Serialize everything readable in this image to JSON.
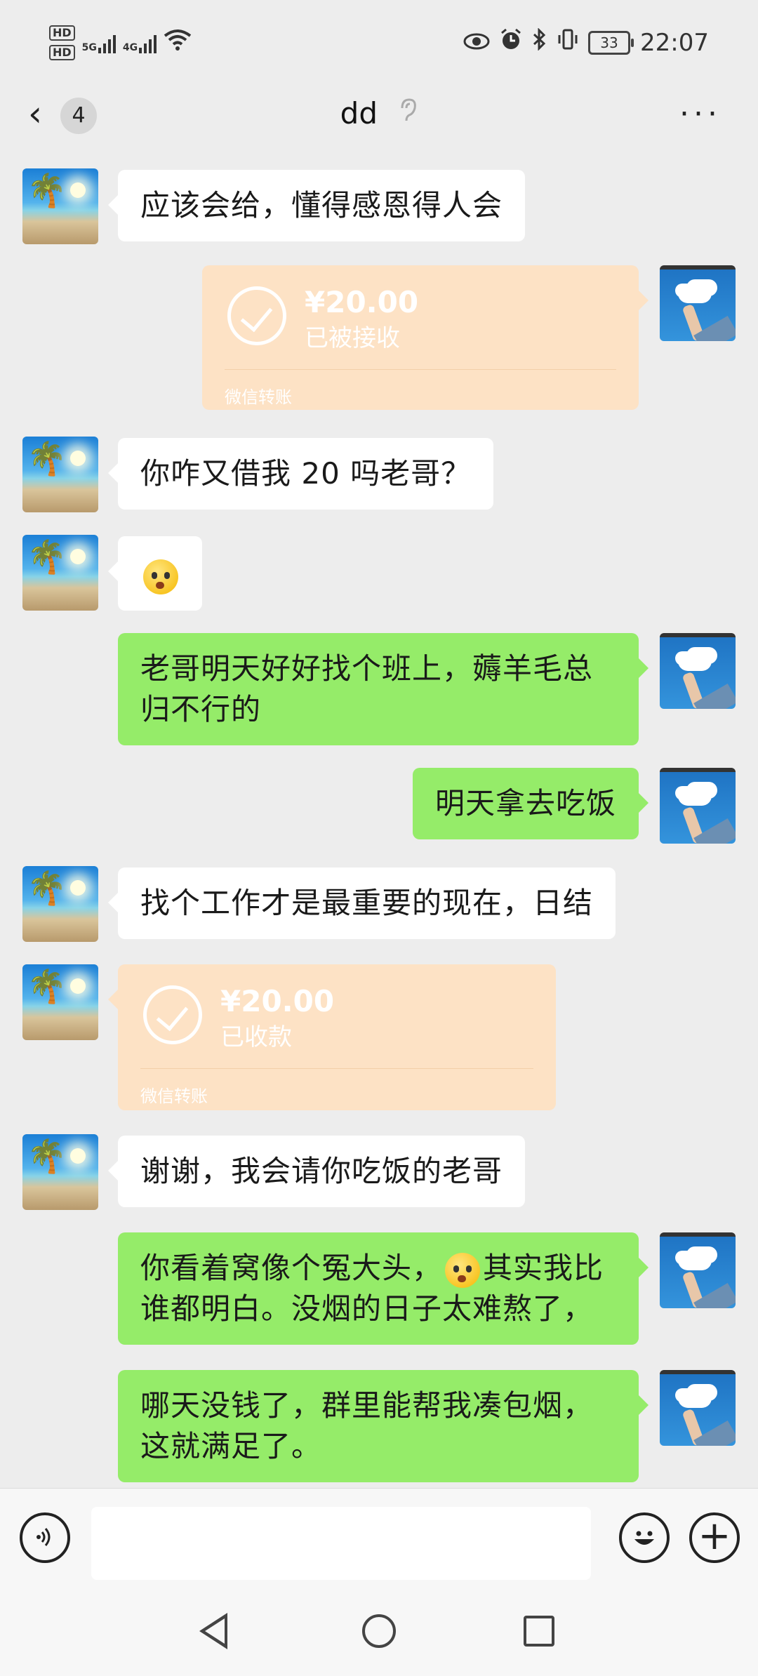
{
  "status_bar": {
    "hd1": "HD",
    "hd2": "HD",
    "net1": "5G",
    "net2": "4G",
    "battery": "33",
    "time": "22:07"
  },
  "header": {
    "back_symbol": "‹",
    "unread_count": "4",
    "title": "dd",
    "ear_icon": "ear-icon",
    "more_icon": "···"
  },
  "messages": [
    {
      "side": "left",
      "type": "text",
      "text": "应该会给，懂得感恩得人会"
    },
    {
      "side": "right",
      "type": "transfer",
      "amount": "¥20.00",
      "status": "已被接收",
      "footer": "微信转账"
    },
    {
      "side": "left",
      "type": "text",
      "text": "你咋又借我 20 吗老哥？"
    },
    {
      "side": "left",
      "type": "emoji",
      "icon": "shocked-face-emoji"
    },
    {
      "side": "right",
      "type": "text",
      "text": "老哥明天好好找个班上，薅羊毛总归不行的"
    },
    {
      "side": "right",
      "type": "text",
      "text": "明天拿去吃饭"
    },
    {
      "side": "left",
      "type": "text",
      "text": "找个工作才是最重要的现在，日结"
    },
    {
      "side": "left",
      "type": "transfer",
      "amount": "¥20.00",
      "status": "已收款",
      "footer": "微信转账"
    },
    {
      "side": "left",
      "type": "text",
      "text": "谢谢，我会请你吃饭的老哥"
    },
    {
      "side": "right",
      "type": "text",
      "text_before": "你看着窝像个冤大头，",
      "text_after": "其实我比谁都明白。没烟的日子太难熬了，"
    },
    {
      "side": "right",
      "type": "text",
      "text": "哪天没钱了，群里能帮我凑包烟，这就满足了。"
    }
  ],
  "input_bar": {
    "text_value": "",
    "voice_icon": "voice-icon",
    "emoji_icon": "emoji-icon",
    "plus_symbol": "+"
  },
  "colors": {
    "background": "#ededed",
    "bubble_self": "#95ec69",
    "bubble_other": "#ffffff",
    "transfer": "#fde2c5"
  }
}
